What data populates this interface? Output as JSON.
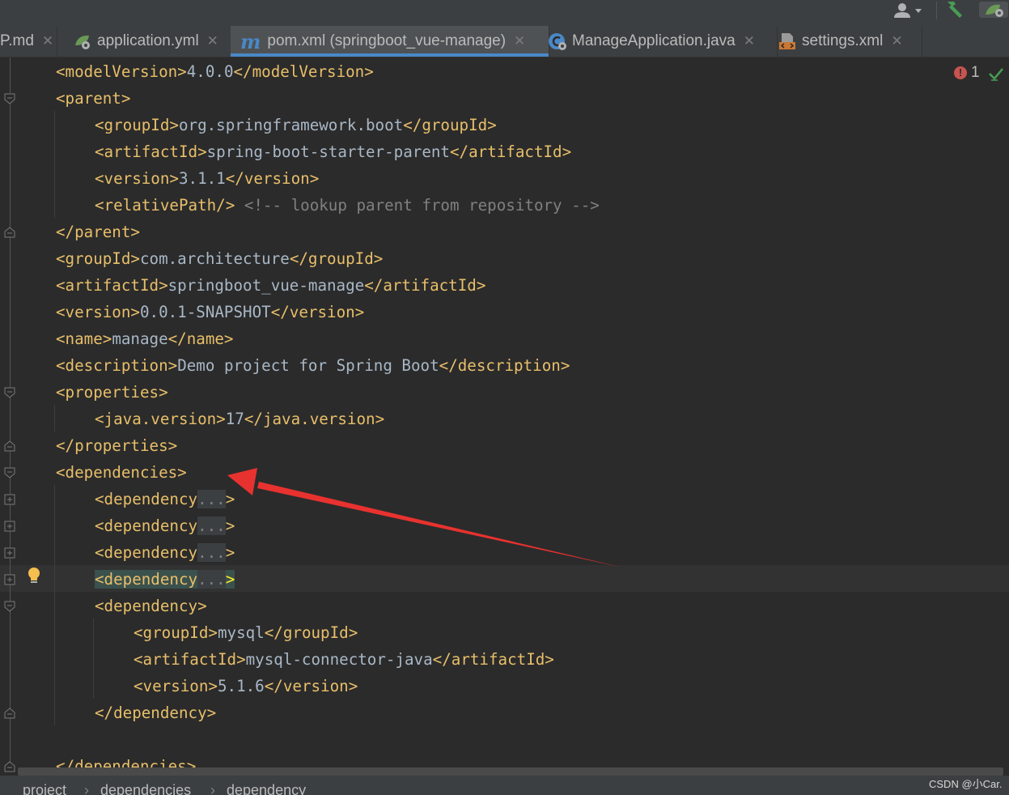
{
  "tabs": [
    {
      "label": "P.md",
      "active": false,
      "icon": "markdown-file-icon"
    },
    {
      "label": "application.yml",
      "active": false,
      "icon": "spring-config-icon"
    },
    {
      "label": "pom.xml (springboot_vue-manage)",
      "active": true,
      "icon": "maven-icon"
    },
    {
      "label": "ManageApplication.java",
      "active": false,
      "icon": "java-class-icon"
    },
    {
      "label": "settings.xml",
      "active": false,
      "icon": "xml-file-icon"
    }
  ],
  "close_glyph": "✕",
  "maven_icon_glyph": "m",
  "inspections": {
    "error_count": "1",
    "error_glyph": "!"
  },
  "code": {
    "l1": {
      "t1": "<modelVersion>",
      "v": "4.0.0",
      "t2": "</modelVersion>"
    },
    "l2": {
      "t1": "<parent>"
    },
    "l3": {
      "t1": "<groupId>",
      "v": "org.springframework.boot",
      "t2": "</groupId>"
    },
    "l4": {
      "t1": "<artifactId>",
      "v": "spring-boot-starter-parent",
      "t2": "</artifactId>"
    },
    "l5": {
      "t1": "<version>",
      "v": "3.1.1",
      "t2": "</version>"
    },
    "l6": {
      "t1": "<relativePath/>",
      "c": " <!-- lookup parent from repository -->"
    },
    "l7": {
      "t1": "</parent>"
    },
    "l8": {
      "t1": "<groupId>",
      "v": "com.architecture",
      "t2": "</groupId>"
    },
    "l9": {
      "t1": "<artifactId>",
      "v": "springboot_vue-manage",
      "t2": "</artifactId>"
    },
    "l10": {
      "t1": "<version>",
      "v": "0.0.1-SNAPSHOT",
      "t2": "</version>"
    },
    "l11": {
      "t1": "<name>",
      "v": "manage",
      "t2": "</name>"
    },
    "l12": {
      "t1": "<description>",
      "v": "Demo project for Spring Boot",
      "t2": "</description>"
    },
    "l13": {
      "t1": "<properties>"
    },
    "l14": {
      "t1": "<java.version>",
      "v": "17",
      "t2": "</java.version>"
    },
    "l15": {
      "t1": "</properties>"
    },
    "l16": {
      "t1": "<dependencies>"
    },
    "l17": {
      "t1": "<dependency",
      "f": "...",
      "t2": ">"
    },
    "l18": {
      "t1": "<dependency",
      "f": "...",
      "t2": ">"
    },
    "l19": {
      "t1": "<dependency",
      "f": "...",
      "t2": ">"
    },
    "l20": {
      "t1": "<dependency",
      "f": "...",
      "t2": ">"
    },
    "l21": {
      "t1": "<dependency>"
    },
    "l22": {
      "t1": "<groupId>",
      "v": "mysql",
      "t2": "</groupId>"
    },
    "l23": {
      "t1": "<artifactId>",
      "v": "mysql-connector-java",
      "t2": "</artifactId>"
    },
    "l24": {
      "t1": "<version>",
      "v": "5.1.6",
      "t2": "</version>"
    },
    "l25": {
      "t1": "</dependency>"
    },
    "l26": {
      "t1": "</dependencies>"
    }
  },
  "breadcrumb": [
    "project",
    "dependencies",
    "dependency"
  ],
  "breadcrumb_sep": "›",
  "watermark": "CSDN @小Car.",
  "colors": {
    "tag": "#e8bf6a",
    "text": "#a9b7c6",
    "comment": "#808080",
    "background": "#2b2b2b",
    "annotation_arrow": "#e8322f",
    "active_tab_underline": "#4a88c7"
  }
}
